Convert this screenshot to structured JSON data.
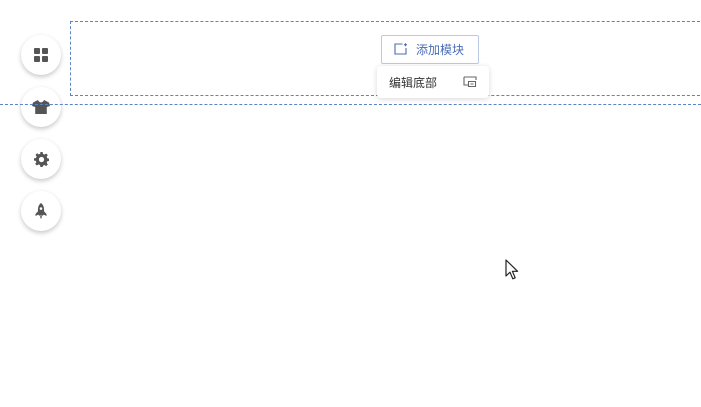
{
  "toolbar": {
    "items": [
      {
        "icon": "grid-icon"
      },
      {
        "icon": "shirt-icon"
      },
      {
        "icon": "gear-icon"
      },
      {
        "icon": "rocket-icon"
      }
    ]
  },
  "editor": {
    "add_module_label": "添加模块",
    "edit_footer_label": "编辑底部"
  },
  "colors": {
    "dashed_border": "#5b84c7",
    "accent_text": "#4a6cb8",
    "icon_gray": "#555555"
  }
}
